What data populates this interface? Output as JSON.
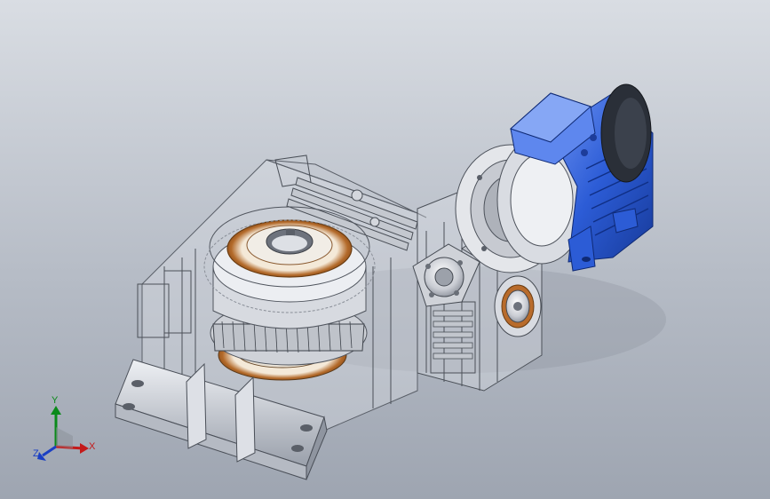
{
  "viewport": {
    "background_top": "#d9dde3",
    "background_bottom": "#9ea5b1",
    "model": "gear-reducer-assembly"
  },
  "triad": {
    "x_label": "X",
    "y_label": "Y",
    "z_label": "Z",
    "x_color": "#c41a1a",
    "y_color": "#0a8a1a",
    "z_color": "#1a3fc4"
  }
}
